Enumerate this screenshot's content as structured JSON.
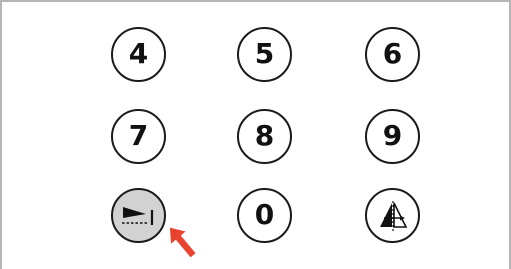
{
  "keypad": {
    "keys": {
      "k4": "4",
      "k5": "5",
      "k6": "6",
      "k7": "7",
      "k8": "8",
      "k9": "9",
      "k0": "0"
    },
    "pressed_key_icon": "tab-indent-icon",
    "right_bottom_key_icon": "mirror-symmetry-icon"
  },
  "pointer": {
    "icon": "red-arrow-pointer",
    "color": "#e8432f"
  },
  "colors": {
    "key_border": "#1a1a1a",
    "pressed_key_fill": "#d2d2d2",
    "panel_border": "#b5b5b5"
  }
}
